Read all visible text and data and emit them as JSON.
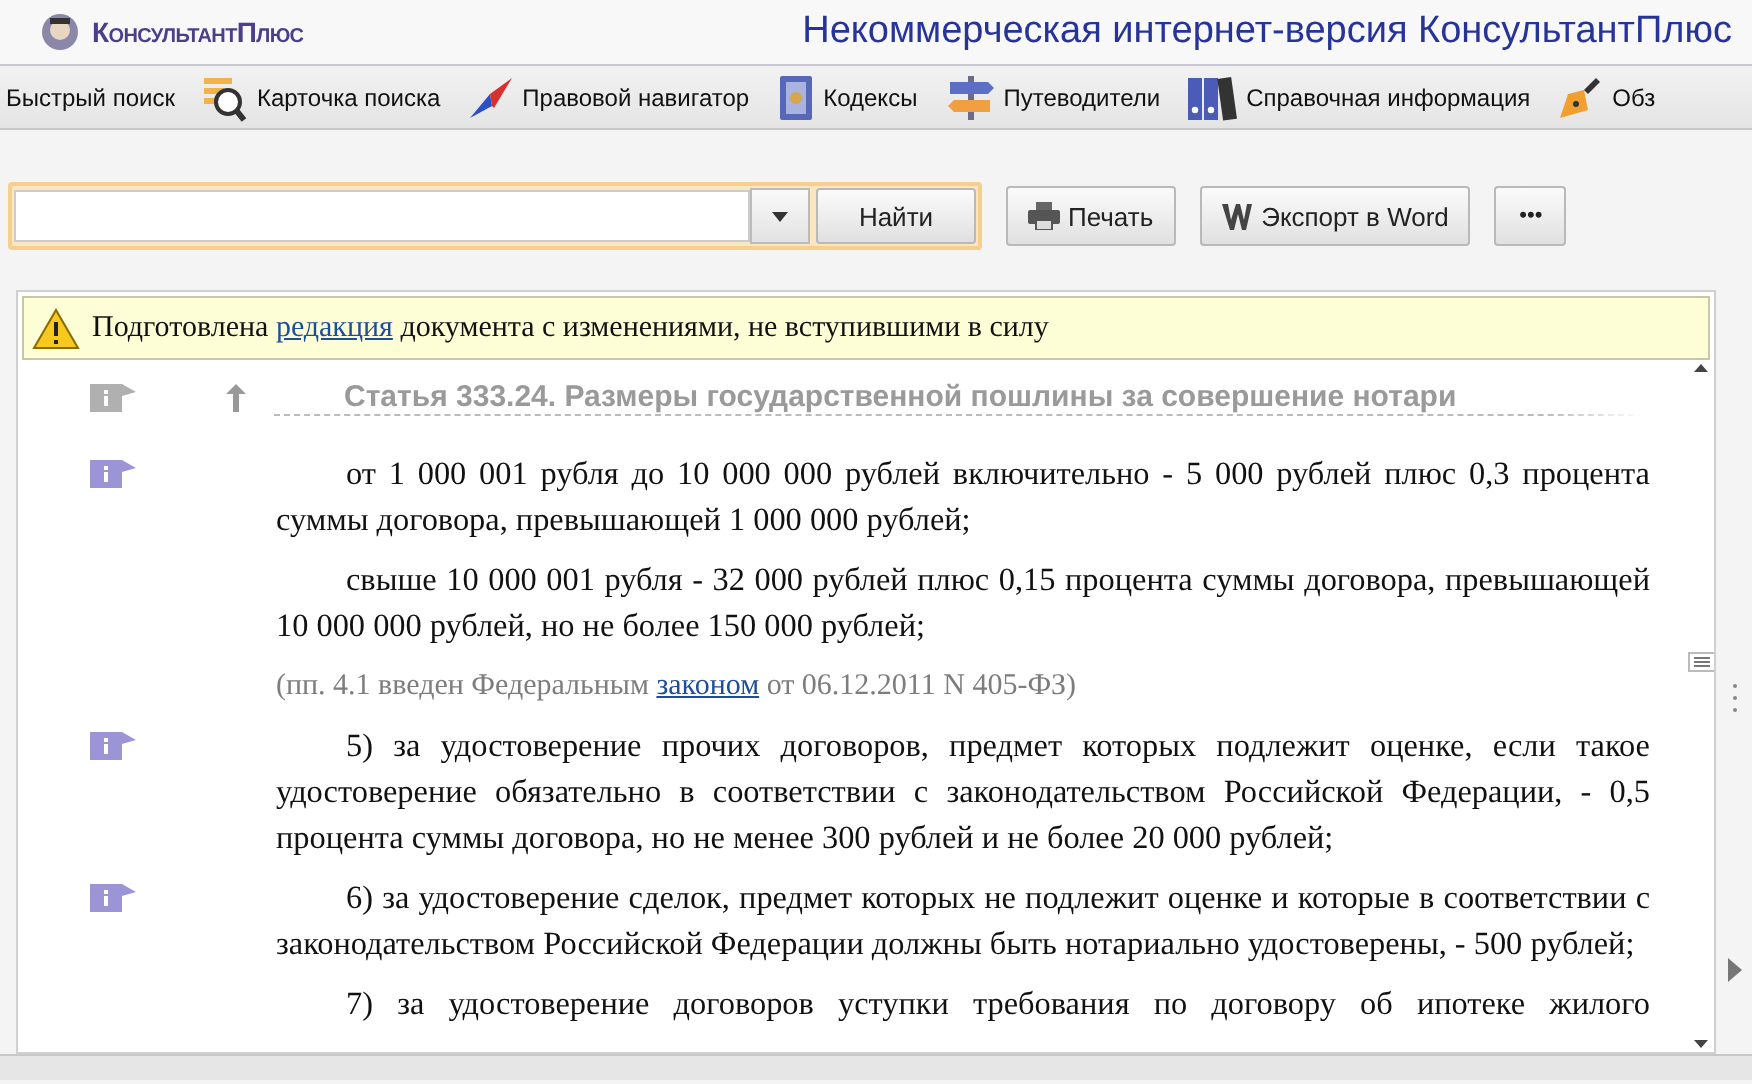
{
  "header": {
    "logo_text": "КонсультантПлюс",
    "title": "Некоммерческая интернет-версия КонсультантПлюс"
  },
  "toolbar": {
    "items": [
      {
        "label": "Быстрый поиск"
      },
      {
        "label": "Карточка поиска"
      },
      {
        "label": "Правовой навигатор"
      },
      {
        "label": "Кодексы"
      },
      {
        "label": "Путеводители"
      },
      {
        "label": "Справочная информация"
      },
      {
        "label": "Обз"
      }
    ]
  },
  "search": {
    "find_button": "Найти",
    "buttons": [
      "Печать",
      "Экспорт в Word",
      "•••"
    ]
  },
  "notice": {
    "before": "Подготовлена",
    "link": "редакция",
    "after": "документа с изменениями, не вступившими в силу"
  },
  "document": {
    "heading": "Статья 333.24. Размеры государственной пошлины за совершение нотари",
    "paragraphs": [
      {
        "kind": "para",
        "marker": true,
        "text": "от 1 000 001 рубля до 10 000 000 рублей включительно - 5 000 рублей плюс 0,3 процента суммы договора, превышающей 1 000 000 рублей;"
      },
      {
        "kind": "para",
        "marker": false,
        "text": "свыше 10 000 001 рубля - 32 000 рублей плюс 0,15 процента суммы договора, превышающей 10 000 000 рублей, но не более 150 000 рублей;"
      },
      {
        "kind": "note",
        "marker": false,
        "before": "(пп. 4.1 введен Федеральным",
        "link": "законом",
        "after": "от 06.12.2011 N 405-ФЗ)"
      },
      {
        "kind": "para",
        "marker": true,
        "text": "5) за удостоверение прочих договоров, предмет которых подлежит оценке, если такое удостоверение обязательно в соответствии с законодательством Российской Федерации, - 0,5 процента суммы договора, но не менее 300 рублей и не более 20 000 рублей;"
      },
      {
        "kind": "para",
        "marker": true,
        "text": "6) за удостоверение сделок, предмет которых не подлежит оценке и которые в соответствии с законодательством Российской Федерации должны быть нотариально удостоверены, - 500 рублей;"
      },
      {
        "kind": "cut",
        "marker": false,
        "text": "7) за удостоверение договоров уступки требования по договору об ипотеке жилого"
      }
    ]
  }
}
